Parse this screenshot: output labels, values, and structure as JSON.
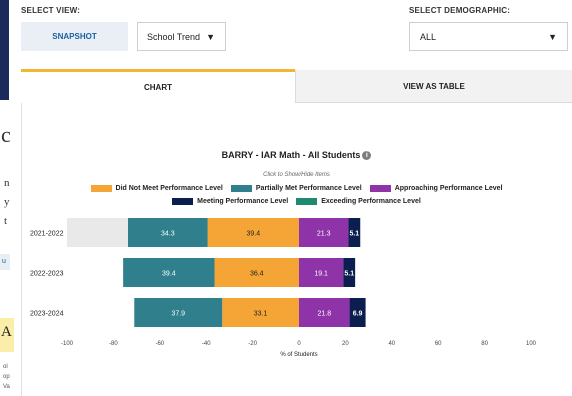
{
  "labels": {
    "select_view": "SELECT VIEW:",
    "select_demographic": "SELECT DEMOGRAPHIC:"
  },
  "view_buttons": {
    "snapshot": "SNAPSHOT",
    "view_select_value": "School Trend"
  },
  "demographic_select_value": "ALL",
  "tabs": {
    "chart": "CHART",
    "table": "VIEW AS TABLE"
  },
  "left_fragment": {
    "big_letter": "c",
    "boxed_letter": "A",
    "blue_tag": "u"
  },
  "chart_data": {
    "type": "bar",
    "orientation": "horizontal-diverging-stacked",
    "title": "BARRY - IAR Math - All Students",
    "hint": "Click to Show/Hide Items",
    "xlabel": "% of Students",
    "xlim": [
      -100,
      100
    ],
    "xticks": [
      -100,
      -80,
      -60,
      -40,
      -20,
      0,
      20,
      40,
      60,
      80,
      100
    ],
    "legend_placement": "top",
    "categories": [
      "2021-2022",
      "2022-2023",
      "2023-2024"
    ],
    "series": [
      {
        "name": "Did Not Meet Performance Level",
        "color": "#f4a535",
        "side": "negative",
        "values": [
          39.4,
          36.4,
          33.1
        ]
      },
      {
        "name": "Partially Met Performance Level",
        "color": "#2f7f8c",
        "side": "negative",
        "values": [
          34.3,
          39.4,
          37.9
        ]
      },
      {
        "name": "Approaching Performance Level",
        "color": "#8e34a8",
        "side": "positive",
        "values": [
          21.3,
          19.1,
          21.8
        ]
      },
      {
        "name": "Meeting Performance Level",
        "color": "#0b1e4f",
        "side": "positive",
        "values": [
          5.1,
          5.1,
          6.9
        ]
      },
      {
        "name": "Exceeding Performance Level",
        "color": "#1e8a72",
        "side": "positive",
        "values": [
          0,
          0,
          0
        ]
      }
    ],
    "hover_highlight_category": "2021-2022"
  }
}
